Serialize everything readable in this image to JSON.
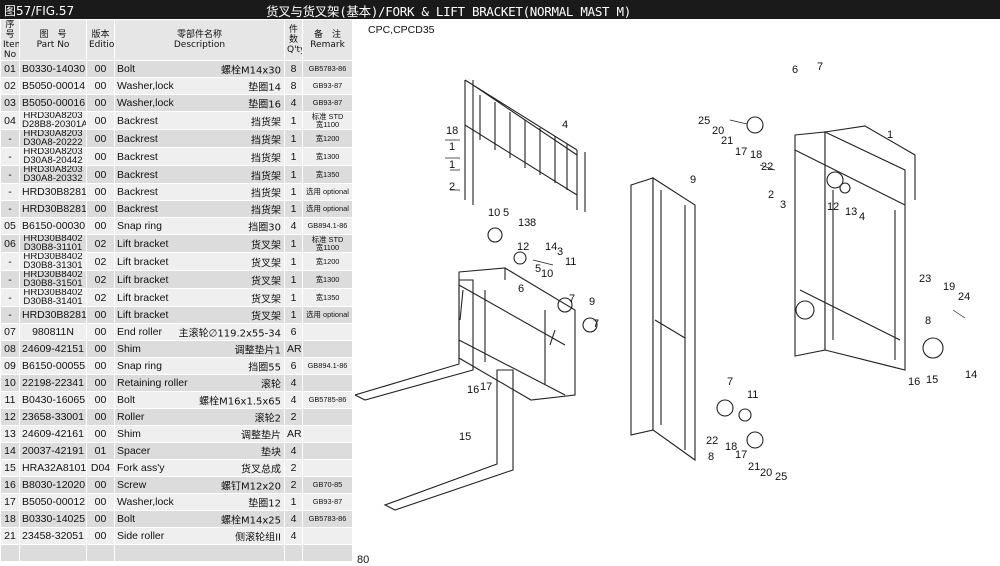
{
  "header": {
    "fig_label": "图57/FIG.57",
    "title": "货叉与货叉架(基本)/FORK & LIFT BRACKET(NORMAL MAST M)"
  },
  "columns": {
    "item_cn": "序号",
    "item_en": "Item No",
    "part_cn": "图　号",
    "part_en": "Part No",
    "ed_cn": "版本",
    "ed_en": "Edition",
    "desc_cn": "零部件名称",
    "desc_en": "Description",
    "qty_cn": "件数",
    "qty_en": "Q'ty",
    "rem_cn": "备　注",
    "rem_en": "Remark"
  },
  "rows": [
    {
      "no": "01",
      "pn": "B0330-14030",
      "pn2": "",
      "ed": "00",
      "en": "Bolt",
      "cn": "螺栓M14x30",
      "qty": "8",
      "rem": "GB5783-86",
      "rem2": ""
    },
    {
      "no": "02",
      "pn": "B5050-00014",
      "pn2": "",
      "ed": "00",
      "en": "Washer,lock",
      "cn": "垫圈14",
      "qty": "8",
      "rem": "GB93-87",
      "rem2": ""
    },
    {
      "no": "03",
      "pn": "B5050-00016",
      "pn2": "",
      "ed": "00",
      "en": "Washer,lock",
      "cn": "垫圈16",
      "qty": "4",
      "rem": "GB93-87",
      "rem2": ""
    },
    {
      "no": "04",
      "pn": "HRD30A8203",
      "pn2": "D28B8-20301A",
      "ed": "00",
      "en": "Backrest",
      "cn": "挡货架",
      "qty": "1",
      "rem": "标准 STD",
      "rem2": "宽1100"
    },
    {
      "no": "-",
      "pn": "HRD30A8203",
      "pn2": "D30A8-20222",
      "ed": "00",
      "en": "Backrest",
      "cn": "挡货架",
      "qty": "1",
      "rem": "宽1200",
      "rem2": ""
    },
    {
      "no": "-",
      "pn": "HRD30A8203",
      "pn2": "D30A8-20442",
      "ed": "00",
      "en": "Backrest",
      "cn": "挡货架",
      "qty": "1",
      "rem": "宽1300",
      "rem2": ""
    },
    {
      "no": "-",
      "pn": "HRD30A8203",
      "pn2": "D30A8-20332",
      "ed": "00",
      "en": "Backrest",
      "cn": "挡货架",
      "qty": "1",
      "rem": "宽1350",
      "rem2": ""
    },
    {
      "no": "-",
      "pn": "HRD30B8281H",
      "pn2": "",
      "ed": "00",
      "en": "Backrest",
      "cn": "挡货架",
      "qty": "1",
      "rem": "选用 optional",
      "rem2": ""
    },
    {
      "no": "-",
      "pn": "HRD30B8281W",
      "pn2": "",
      "ed": "00",
      "en": "Backrest",
      "cn": "挡货架",
      "qty": "1",
      "rem": "选用 optional",
      "rem2": ""
    },
    {
      "no": "05",
      "pn": "B6150-00030",
      "pn2": "",
      "ed": "00",
      "en": "Snap ring",
      "cn": "挡圈30",
      "qty": "4",
      "rem": "GB894.1-86",
      "rem2": ""
    },
    {
      "no": "06",
      "pn": "HRD30B8402",
      "pn2": "D30B8-31101",
      "ed": "02",
      "en": "Lift bracket",
      "cn": "货叉架",
      "qty": "1",
      "rem": "标准 STD",
      "rem2": "宽1100"
    },
    {
      "no": "-",
      "pn": "HRD30B8402",
      "pn2": "D30B8-31301",
      "ed": "02",
      "en": "Lift bracket",
      "cn": "货叉架",
      "qty": "1",
      "rem": "宽1200",
      "rem2": ""
    },
    {
      "no": "-",
      "pn": "HRD30B8402",
      "pn2": "D30B8-31501",
      "ed": "02",
      "en": "Lift bracket",
      "cn": "货叉架",
      "qty": "1",
      "rem": "宽1300",
      "rem2": ""
    },
    {
      "no": "-",
      "pn": "HRD30B8402",
      "pn2": "D30B8-31401",
      "ed": "02",
      "en": "Lift bracket",
      "cn": "货叉架",
      "qty": "1",
      "rem": "宽1350",
      "rem2": ""
    },
    {
      "no": "-",
      "pn": "HRD30B8281W",
      "pn2": "",
      "ed": "00",
      "en": "Lift bracket",
      "cn": "货叉架",
      "qty": "1",
      "rem": "选用 optional",
      "rem2": ""
    },
    {
      "no": "07",
      "pn": "980811N",
      "pn2": "",
      "ed": "00",
      "en": "End roller",
      "cn": "主滚轮∅119.2x55-34",
      "qty": "6",
      "rem": "",
      "rem2": ""
    },
    {
      "no": "08",
      "pn": "24609-42151",
      "pn2": "",
      "ed": "00",
      "en": "Shim",
      "cn": "调整垫片1",
      "qty": "AR",
      "rem": "",
      "rem2": ""
    },
    {
      "no": "09",
      "pn": "B6150-00055",
      "pn2": "",
      "ed": "00",
      "en": "Snap ring",
      "cn": "挡圈55",
      "qty": "6",
      "rem": "GB894.1-86",
      "rem2": ""
    },
    {
      "no": "10",
      "pn": "22198-22341",
      "pn2": "",
      "ed": "00",
      "en": "Retaining roller",
      "cn": "滚轮",
      "qty": "4",
      "rem": "",
      "rem2": ""
    },
    {
      "no": "11",
      "pn": "B0430-16065",
      "pn2": "",
      "ed": "00",
      "en": "Bolt",
      "cn": "螺栓M16x1.5x65",
      "qty": "4",
      "rem": "GB5785-86",
      "rem2": ""
    },
    {
      "no": "12",
      "pn": "23658-33001",
      "pn2": "",
      "ed": "00",
      "en": "Roller",
      "cn": "滚轮2",
      "qty": "2",
      "rem": "",
      "rem2": ""
    },
    {
      "no": "13",
      "pn": "24609-42161",
      "pn2": "",
      "ed": "00",
      "en": "Shim",
      "cn": "调整垫片",
      "qty": "AR",
      "rem": "",
      "rem2": ""
    },
    {
      "no": "14",
      "pn": "20037-42191",
      "pn2": "",
      "ed": "01",
      "en": "Spacer",
      "cn": "垫块",
      "qty": "4",
      "rem": "",
      "rem2": ""
    },
    {
      "no": "15",
      "pn": "HRA32A8101",
      "pn2": "",
      "ed": "D04",
      "en": "Fork ass'y",
      "cn": "货叉总成",
      "qty": "2",
      "rem": "",
      "rem2": ""
    },
    {
      "no": "16",
      "pn": "B8030-12020",
      "pn2": "",
      "ed": "00",
      "en": "Screw",
      "cn": "螺钉M12x20",
      "qty": "2",
      "rem": "GB70-85",
      "rem2": ""
    },
    {
      "no": "17",
      "pn": "B5050-00012",
      "pn2": "",
      "ed": "00",
      "en": "Washer,lock",
      "cn": "垫圈12",
      "qty": "1",
      "rem": "GB93-87",
      "rem2": ""
    },
    {
      "no": "18",
      "pn": "B0330-14025",
      "pn2": "",
      "ed": "00",
      "en": "Bolt",
      "cn": "螺栓M14x25",
      "qty": "4",
      "rem": "GB5783-86",
      "rem2": ""
    },
    {
      "no": "21",
      "pn": "23458-32051",
      "pn2": "",
      "ed": "00",
      "en": "Side roller",
      "cn": "侧滚轮组II",
      "qty": "4",
      "rem": "",
      "rem2": ""
    },
    {
      "no": "",
      "pn": "",
      "pn2": "",
      "ed": "",
      "en": "",
      "cn": "",
      "qty": "",
      "rem": "",
      "rem2": ""
    }
  ],
  "diagram": {
    "model": "CPC,CPCD35",
    "page_number": "80",
    "callouts": [
      "1",
      "2",
      "3",
      "4",
      "5",
      "6",
      "7",
      "8",
      "9",
      "10",
      "11",
      "12",
      "13",
      "14",
      "15",
      "16",
      "17",
      "18",
      "19",
      "20",
      "21",
      "22",
      "23",
      "24",
      "25"
    ]
  }
}
